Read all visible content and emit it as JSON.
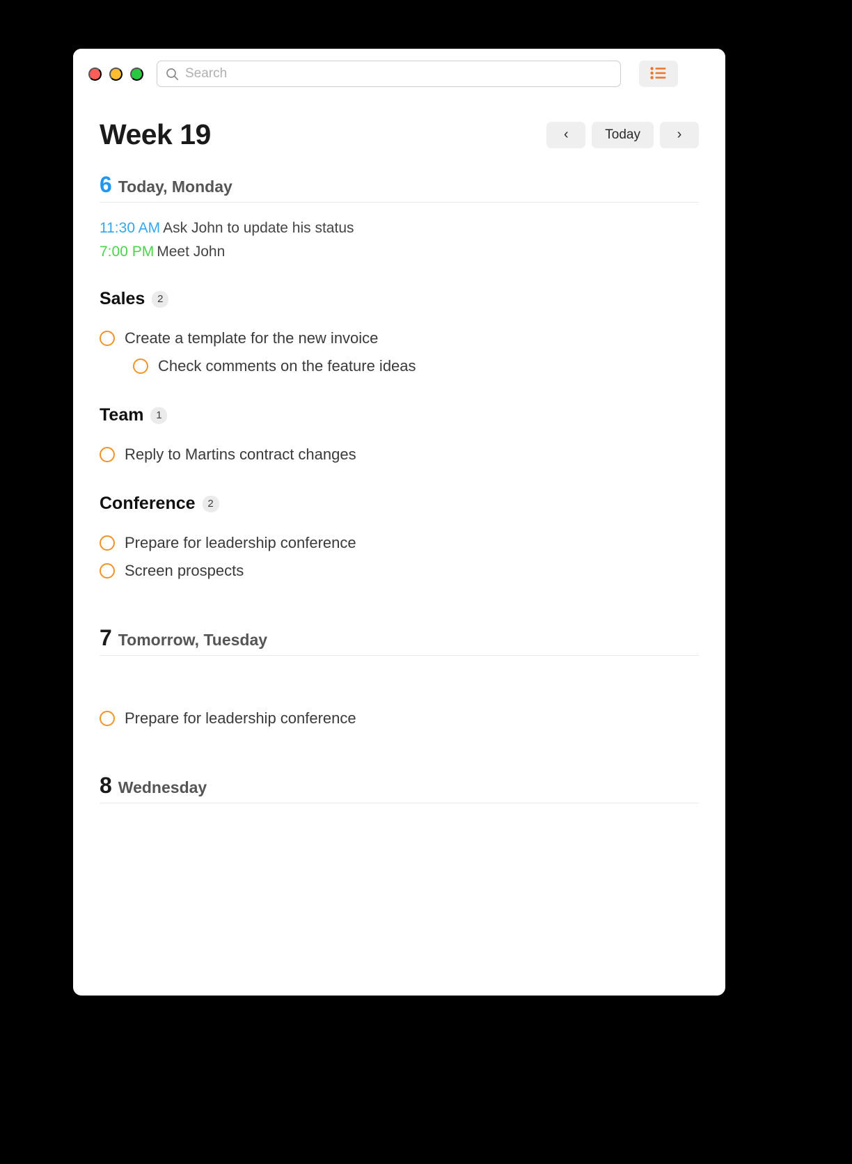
{
  "window": {
    "traffic_lights": [
      "close",
      "minimize",
      "zoom"
    ],
    "colors": {
      "close": "#ff5f57",
      "minimize": "#febc2e",
      "zoom": "#28c840",
      "accent_orange": "#f09326",
      "today_blue": "#2196f3",
      "event_blue": "#32a7ef",
      "event_green": "#4cd24c"
    }
  },
  "search": {
    "placeholder": "Search",
    "value": "",
    "icon": "search-icon"
  },
  "toolbar": {
    "view_toggle_icon": "list-view-icon"
  },
  "header": {
    "title": "Week 19",
    "prev_label": "‹",
    "today_label": "Today",
    "next_label": "›"
  },
  "days": [
    {
      "number": "6",
      "label": "Today, Monday",
      "is_today": true,
      "events": [
        {
          "time": "11:30 AM",
          "time_color": "blue",
          "title": "Ask John to update his status"
        },
        {
          "time": "7:00 PM",
          "time_color": "green",
          "title": "Meet John"
        }
      ],
      "groups": [
        {
          "name": "Sales",
          "count": "2",
          "tasks": [
            {
              "title": "Create a template for the new invoice",
              "indent": false
            },
            {
              "title": "Check comments on the feature ideas",
              "indent": true
            }
          ]
        },
        {
          "name": "Team",
          "count": "1",
          "tasks": [
            {
              "title": "Reply to Martins contract changes",
              "indent": false
            }
          ]
        },
        {
          "name": "Conference",
          "count": "2",
          "tasks": [
            {
              "title": "Prepare for leadership conference",
              "indent": false
            },
            {
              "title": "Screen prospects",
              "indent": false
            }
          ]
        }
      ]
    },
    {
      "number": "7",
      "label": "Tomorrow, Tuesday",
      "is_today": false,
      "events": [],
      "groups": [
        {
          "name": "",
          "count": "",
          "tasks": [
            {
              "title": "Prepare for leadership conference",
              "indent": false
            }
          ]
        }
      ]
    },
    {
      "number": "8",
      "label": "Wednesday",
      "is_today": false,
      "events": [],
      "groups": []
    }
  ]
}
